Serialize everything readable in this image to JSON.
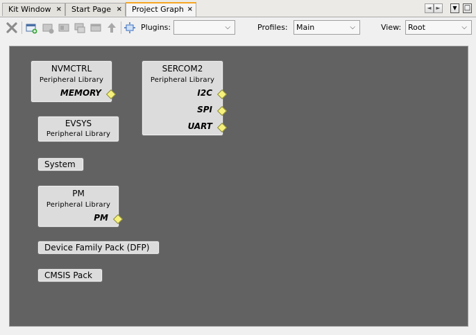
{
  "tabs": [
    {
      "label": "Kit Window",
      "close": "×"
    },
    {
      "label": "Start Page",
      "close": "×"
    },
    {
      "label": "Project Graph",
      "close": "×"
    }
  ],
  "nav": {
    "prev": "◄",
    "next": "►",
    "menu": "▼",
    "maximize": "□"
  },
  "toolbar": {
    "plugins_label": "Plugins:",
    "plugins_value": "",
    "profiles_label": "Profiles:",
    "profiles_value": "Main",
    "view_label": "View:",
    "view_value": "Root",
    "arrow": "⌵"
  },
  "graph": {
    "nvmctrl": {
      "title": "NVMCTRL",
      "subtitle": "Peripheral Library",
      "ports": [
        "MEMORY"
      ]
    },
    "sercom2": {
      "title": "SERCOM2",
      "subtitle": "Peripheral Library",
      "ports": [
        "I2C",
        "SPI",
        "UART"
      ]
    },
    "evsys": {
      "title": "EVSYS",
      "subtitle": "Peripheral Library"
    },
    "system": {
      "title": "System"
    },
    "pm": {
      "title": "PM",
      "subtitle": "Peripheral Library",
      "ports": [
        "PM"
      ]
    },
    "dfp": {
      "title": "Device Family Pack (DFP)"
    },
    "cmsis": {
      "title": "CMSIS Pack"
    }
  },
  "colors": {
    "canvas": "#626262",
    "node": "#dcdcdc",
    "port_diamond": "#f6f17c",
    "active_tab_accent": "#f5a623"
  }
}
